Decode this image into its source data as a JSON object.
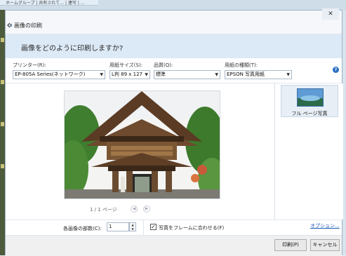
{
  "background": {
    "tab_text": "ホームグループ | 共有されて… | 連写 | …"
  },
  "dialog": {
    "title": "画像の印刷",
    "close_label": "✕",
    "question": "画像をどのように印刷しますか?"
  },
  "settings": {
    "printer": {
      "label": "プリンター(R):",
      "value": "EP-805A Series(ネットワーク)"
    },
    "paper_size": {
      "label": "用紙サイズ(S):",
      "value": "L判 89 x 127"
    },
    "quality": {
      "label": "品質(Q):",
      "value": "標準"
    },
    "paper_type": {
      "label": "用紙の種類(T):",
      "value": "EPSON 写真用紙"
    },
    "help_label": "?"
  },
  "preview": {
    "pager_text": "1 / 1 ページ",
    "prev_icon": "chevron-left-icon",
    "next_icon": "chevron-right-icon"
  },
  "layouts": [
    {
      "label": "フル ページ写真",
      "icon": "photo-thumbnail-icon"
    }
  ],
  "bottom": {
    "copies_label": "各画像の部数(C):",
    "copies_value": "1",
    "fit_checkbox_label": "写真をフレームに合わせる(F)",
    "fit_checked": true,
    "options_link": "オプション..."
  },
  "footer": {
    "print_button": "印刷(P)",
    "cancel_button": "キャンセル"
  },
  "colors": {
    "banner": "#dce9f6",
    "link": "#1c5bb8",
    "help_icon": "#2b6fc2"
  }
}
